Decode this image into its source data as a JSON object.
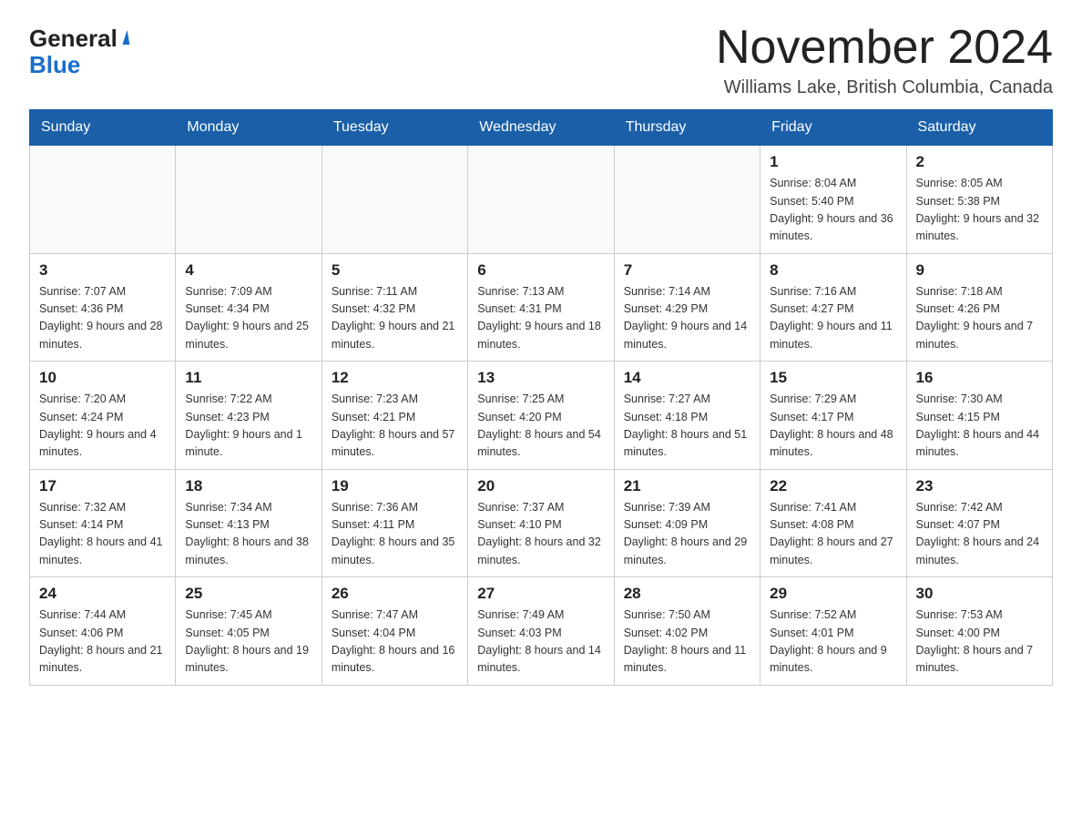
{
  "header": {
    "logo_general": "General",
    "logo_blue": "Blue",
    "month_title": "November 2024",
    "location": "Williams Lake, British Columbia, Canada"
  },
  "days_of_week": [
    "Sunday",
    "Monday",
    "Tuesday",
    "Wednesday",
    "Thursday",
    "Friday",
    "Saturday"
  ],
  "weeks": [
    [
      {
        "day": "",
        "sunrise": "",
        "sunset": "",
        "daylight": ""
      },
      {
        "day": "",
        "sunrise": "",
        "sunset": "",
        "daylight": ""
      },
      {
        "day": "",
        "sunrise": "",
        "sunset": "",
        "daylight": ""
      },
      {
        "day": "",
        "sunrise": "",
        "sunset": "",
        "daylight": ""
      },
      {
        "day": "",
        "sunrise": "",
        "sunset": "",
        "daylight": ""
      },
      {
        "day": "1",
        "sunrise": "Sunrise: 8:04 AM",
        "sunset": "Sunset: 5:40 PM",
        "daylight": "Daylight: 9 hours and 36 minutes."
      },
      {
        "day": "2",
        "sunrise": "Sunrise: 8:05 AM",
        "sunset": "Sunset: 5:38 PM",
        "daylight": "Daylight: 9 hours and 32 minutes."
      }
    ],
    [
      {
        "day": "3",
        "sunrise": "Sunrise: 7:07 AM",
        "sunset": "Sunset: 4:36 PM",
        "daylight": "Daylight: 9 hours and 28 minutes."
      },
      {
        "day": "4",
        "sunrise": "Sunrise: 7:09 AM",
        "sunset": "Sunset: 4:34 PM",
        "daylight": "Daylight: 9 hours and 25 minutes."
      },
      {
        "day": "5",
        "sunrise": "Sunrise: 7:11 AM",
        "sunset": "Sunset: 4:32 PM",
        "daylight": "Daylight: 9 hours and 21 minutes."
      },
      {
        "day": "6",
        "sunrise": "Sunrise: 7:13 AM",
        "sunset": "Sunset: 4:31 PM",
        "daylight": "Daylight: 9 hours and 18 minutes."
      },
      {
        "day": "7",
        "sunrise": "Sunrise: 7:14 AM",
        "sunset": "Sunset: 4:29 PM",
        "daylight": "Daylight: 9 hours and 14 minutes."
      },
      {
        "day": "8",
        "sunrise": "Sunrise: 7:16 AM",
        "sunset": "Sunset: 4:27 PM",
        "daylight": "Daylight: 9 hours and 11 minutes."
      },
      {
        "day": "9",
        "sunrise": "Sunrise: 7:18 AM",
        "sunset": "Sunset: 4:26 PM",
        "daylight": "Daylight: 9 hours and 7 minutes."
      }
    ],
    [
      {
        "day": "10",
        "sunrise": "Sunrise: 7:20 AM",
        "sunset": "Sunset: 4:24 PM",
        "daylight": "Daylight: 9 hours and 4 minutes."
      },
      {
        "day": "11",
        "sunrise": "Sunrise: 7:22 AM",
        "sunset": "Sunset: 4:23 PM",
        "daylight": "Daylight: 9 hours and 1 minute."
      },
      {
        "day": "12",
        "sunrise": "Sunrise: 7:23 AM",
        "sunset": "Sunset: 4:21 PM",
        "daylight": "Daylight: 8 hours and 57 minutes."
      },
      {
        "day": "13",
        "sunrise": "Sunrise: 7:25 AM",
        "sunset": "Sunset: 4:20 PM",
        "daylight": "Daylight: 8 hours and 54 minutes."
      },
      {
        "day": "14",
        "sunrise": "Sunrise: 7:27 AM",
        "sunset": "Sunset: 4:18 PM",
        "daylight": "Daylight: 8 hours and 51 minutes."
      },
      {
        "day": "15",
        "sunrise": "Sunrise: 7:29 AM",
        "sunset": "Sunset: 4:17 PM",
        "daylight": "Daylight: 8 hours and 48 minutes."
      },
      {
        "day": "16",
        "sunrise": "Sunrise: 7:30 AM",
        "sunset": "Sunset: 4:15 PM",
        "daylight": "Daylight: 8 hours and 44 minutes."
      }
    ],
    [
      {
        "day": "17",
        "sunrise": "Sunrise: 7:32 AM",
        "sunset": "Sunset: 4:14 PM",
        "daylight": "Daylight: 8 hours and 41 minutes."
      },
      {
        "day": "18",
        "sunrise": "Sunrise: 7:34 AM",
        "sunset": "Sunset: 4:13 PM",
        "daylight": "Daylight: 8 hours and 38 minutes."
      },
      {
        "day": "19",
        "sunrise": "Sunrise: 7:36 AM",
        "sunset": "Sunset: 4:11 PM",
        "daylight": "Daylight: 8 hours and 35 minutes."
      },
      {
        "day": "20",
        "sunrise": "Sunrise: 7:37 AM",
        "sunset": "Sunset: 4:10 PM",
        "daylight": "Daylight: 8 hours and 32 minutes."
      },
      {
        "day": "21",
        "sunrise": "Sunrise: 7:39 AM",
        "sunset": "Sunset: 4:09 PM",
        "daylight": "Daylight: 8 hours and 29 minutes."
      },
      {
        "day": "22",
        "sunrise": "Sunrise: 7:41 AM",
        "sunset": "Sunset: 4:08 PM",
        "daylight": "Daylight: 8 hours and 27 minutes."
      },
      {
        "day": "23",
        "sunrise": "Sunrise: 7:42 AM",
        "sunset": "Sunset: 4:07 PM",
        "daylight": "Daylight: 8 hours and 24 minutes."
      }
    ],
    [
      {
        "day": "24",
        "sunrise": "Sunrise: 7:44 AM",
        "sunset": "Sunset: 4:06 PM",
        "daylight": "Daylight: 8 hours and 21 minutes."
      },
      {
        "day": "25",
        "sunrise": "Sunrise: 7:45 AM",
        "sunset": "Sunset: 4:05 PM",
        "daylight": "Daylight: 8 hours and 19 minutes."
      },
      {
        "day": "26",
        "sunrise": "Sunrise: 7:47 AM",
        "sunset": "Sunset: 4:04 PM",
        "daylight": "Daylight: 8 hours and 16 minutes."
      },
      {
        "day": "27",
        "sunrise": "Sunrise: 7:49 AM",
        "sunset": "Sunset: 4:03 PM",
        "daylight": "Daylight: 8 hours and 14 minutes."
      },
      {
        "day": "28",
        "sunrise": "Sunrise: 7:50 AM",
        "sunset": "Sunset: 4:02 PM",
        "daylight": "Daylight: 8 hours and 11 minutes."
      },
      {
        "day": "29",
        "sunrise": "Sunrise: 7:52 AM",
        "sunset": "Sunset: 4:01 PM",
        "daylight": "Daylight: 8 hours and 9 minutes."
      },
      {
        "day": "30",
        "sunrise": "Sunrise: 7:53 AM",
        "sunset": "Sunset: 4:00 PM",
        "daylight": "Daylight: 8 hours and 7 minutes."
      }
    ]
  ]
}
